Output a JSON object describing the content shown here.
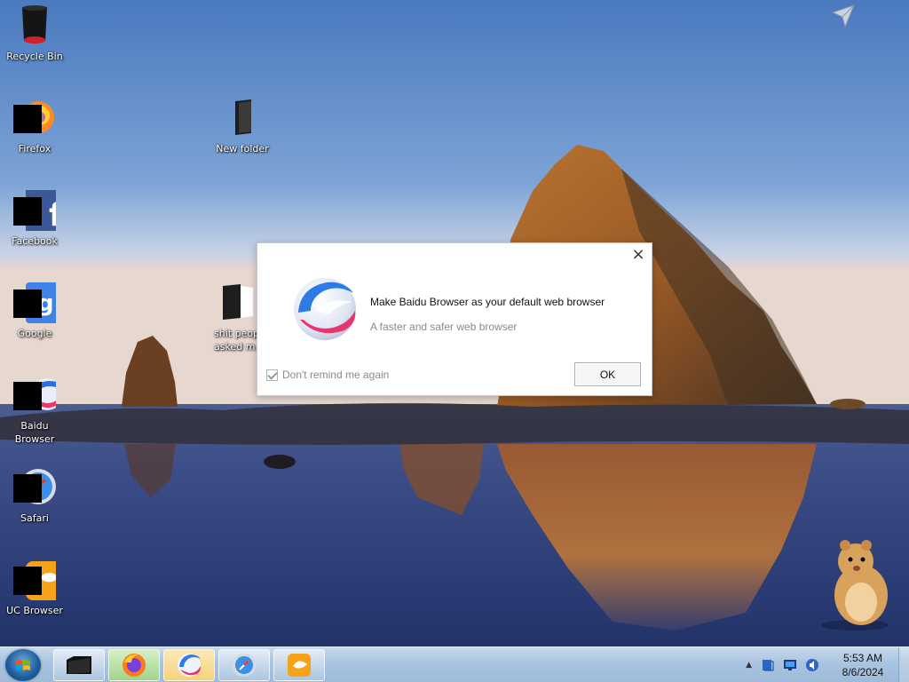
{
  "desktop": {
    "icons": [
      {
        "label": "Recycle Bin"
      },
      {
        "label": "Firefox"
      },
      {
        "label": "Facebook"
      },
      {
        "label": "Google"
      },
      {
        "label": "Baidu\nBrowser"
      },
      {
        "label": "Safari"
      },
      {
        "label": "UC Browser"
      },
      {
        "label": "New folder"
      },
      {
        "label": "shit peop\nasked m"
      }
    ]
  },
  "dialog": {
    "title": "Make Baidu Browser as your default web browser",
    "subtitle": "A faster and safer web browser",
    "remind_label": "Don't remind me again",
    "remind_checked": true,
    "ok_label": "OK",
    "close_icon": "close-icon"
  },
  "taskbar": {
    "start_icon": "windows-start-icon",
    "pinned": [
      "file-explorer",
      "firefox",
      "baidu-browser",
      "safari",
      "uc-browser"
    ],
    "clock": {
      "time": "5:53 AM",
      "date": "8/6/2024"
    }
  },
  "colors": {
    "dialog_bg": "#ffffff",
    "taskbar": "#a9c4e0"
  }
}
